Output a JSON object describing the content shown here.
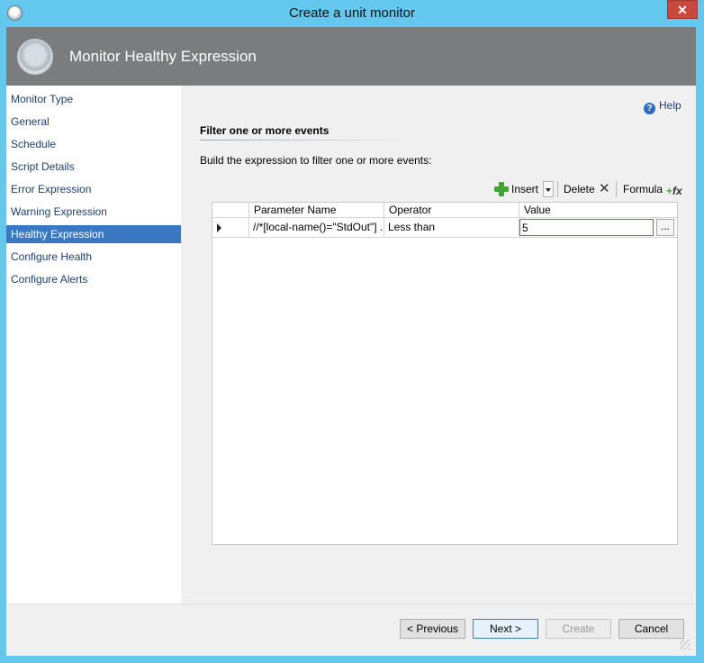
{
  "window": {
    "title": "Create a unit monitor",
    "close_glyph": "✕"
  },
  "header": {
    "title": "Monitor Healthy Expression"
  },
  "nav": {
    "items": [
      {
        "label": "Monitor Type"
      },
      {
        "label": "General"
      },
      {
        "label": "Schedule"
      },
      {
        "label": "Script Details"
      },
      {
        "label": "Error Expression"
      },
      {
        "label": "Warning Expression"
      },
      {
        "label": "Healthy Expression",
        "selected": true
      },
      {
        "label": "Configure Health"
      },
      {
        "label": "Configure Alerts"
      }
    ]
  },
  "content": {
    "help_label": "Help",
    "section_title": "Filter one or more events",
    "instructions": "Build the expression to filter one or more events:"
  },
  "toolbar": {
    "insert_label": "Insert",
    "delete_label": "Delete",
    "formula_label": "Formula"
  },
  "grid": {
    "columns": [
      "Parameter Name",
      "Operator",
      "Value"
    ],
    "rows": [
      {
        "parameter": "//*[local-name()=\"StdOut\"]  ...",
        "operator": "Less than",
        "value": "5"
      }
    ],
    "ellipsis_label": "..."
  },
  "footer": {
    "previous_label": "< Previous",
    "next_label": "Next >",
    "create_label": "Create",
    "cancel_label": "Cancel"
  },
  "colors": {
    "titlebar": "#63c7ee",
    "header": "#7b7c7e",
    "nav_selected": "#3a78c2",
    "close_button": "#c9473d"
  }
}
